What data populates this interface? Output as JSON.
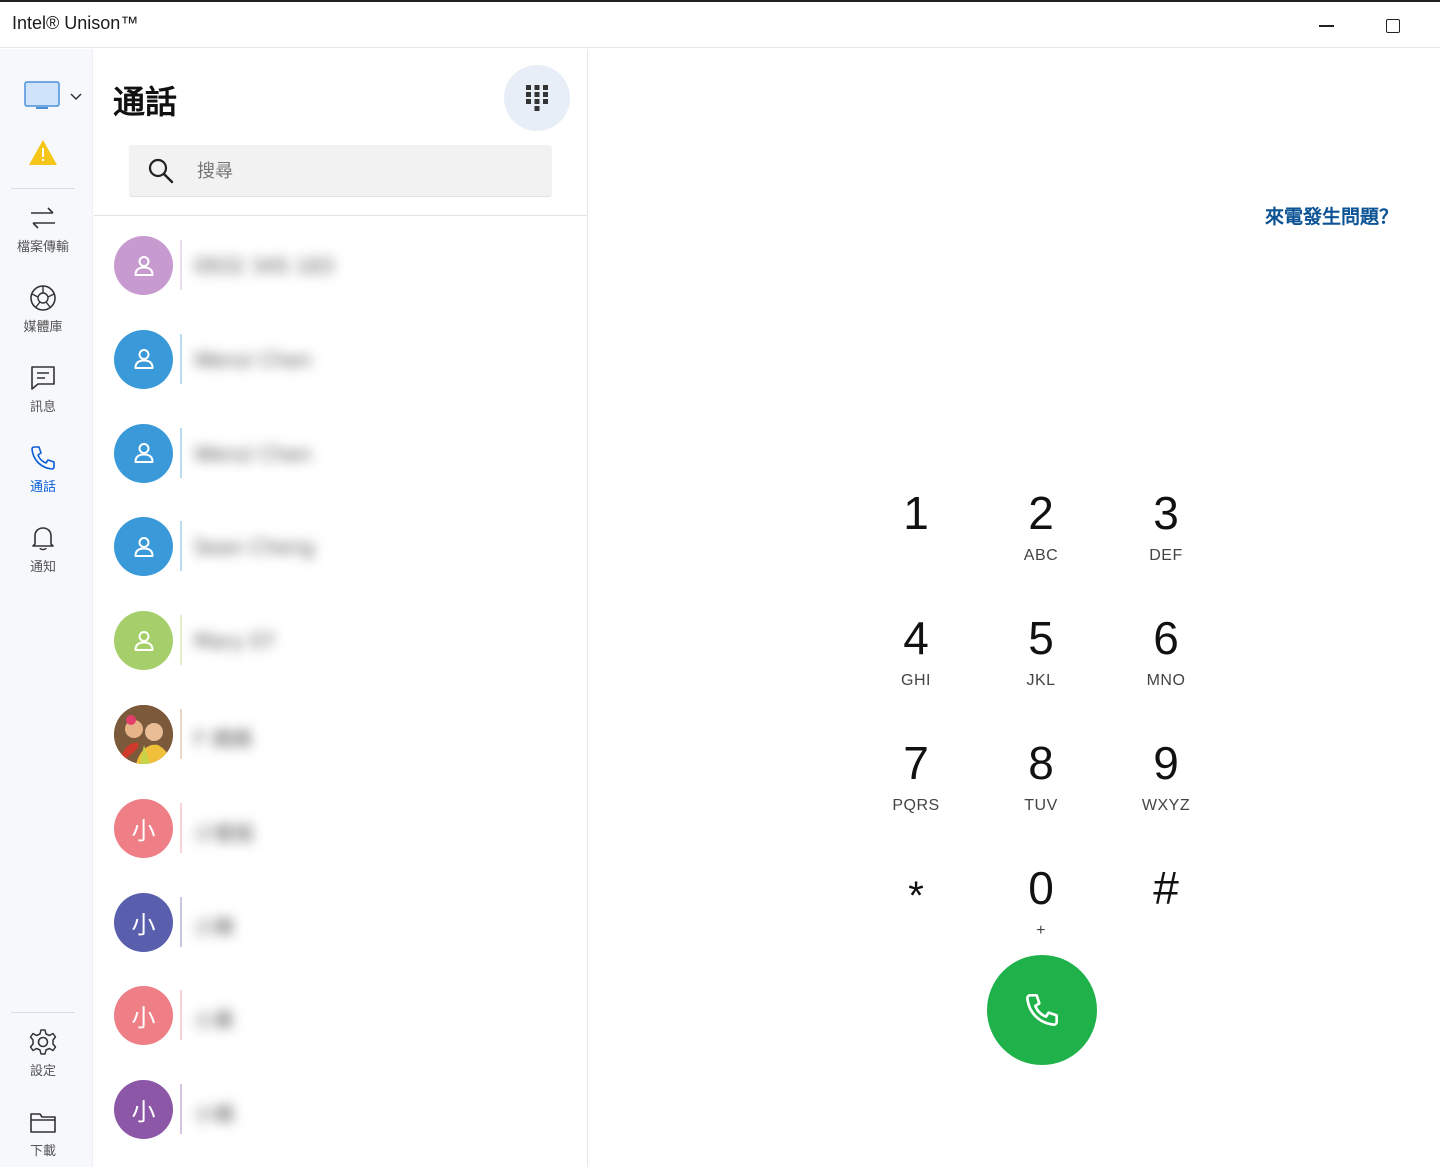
{
  "window": {
    "title": "Intel® Unison™"
  },
  "rail": {
    "device_icon": "monitor-icon",
    "warning_icon": "warning-icon",
    "items": [
      {
        "label": "檔案傳輸",
        "icon": "transfer-icon"
      },
      {
        "label": "媒體庫",
        "icon": "gallery-icon"
      },
      {
        "label": "訊息",
        "icon": "message-icon"
      },
      {
        "label": "通話",
        "icon": "phone-icon",
        "active": true
      },
      {
        "label": "通知",
        "icon": "bell-icon"
      }
    ],
    "bottom_items": [
      {
        "label": "設定",
        "icon": "gear-icon"
      },
      {
        "label": "下載",
        "icon": "folder-icon"
      }
    ],
    "active_color": "#0b5ed7"
  },
  "panel": {
    "title": "通話",
    "dialpad_icon": "dialpad-icon",
    "search": {
      "placeholder": "搜尋",
      "value": ""
    },
    "contacts": [
      {
        "initial": "",
        "color": "#c79bd0",
        "icon": "person-icon",
        "name": "0932 345 183"
      },
      {
        "initial": "",
        "color": "#3a9ad9",
        "icon": "person-icon",
        "name": "Wenzi Chen"
      },
      {
        "initial": "",
        "color": "#3a9ad9",
        "icon": "person-icon",
        "name": "Wenzi Chen"
      },
      {
        "initial": "",
        "color": "#3a9ad9",
        "icon": "person-icon",
        "name": "Sean Cheng"
      },
      {
        "initial": "",
        "color": "#a6cf6b",
        "icon": "person-icon",
        "name": "Mary 07"
      },
      {
        "initial": "",
        "color": "#c98a5c",
        "icon": "photo-avatar",
        "name": "F 媽媽"
      },
      {
        "initial": "小",
        "color": "#ee7f86",
        "icon": "",
        "name": "小瑩姐"
      },
      {
        "initial": "小",
        "color": "#5a5fad",
        "icon": "",
        "name": "小陳"
      },
      {
        "initial": "小",
        "color": "#ee7f86",
        "icon": "",
        "name": "小黃"
      },
      {
        "initial": "小",
        "color": "#8c57a6",
        "icon": "",
        "name": "小楊"
      }
    ]
  },
  "dialer": {
    "help_link": "來電發生問題？",
    "keys": [
      {
        "num": "1",
        "sub": ""
      },
      {
        "num": "2",
        "sub": "ABC"
      },
      {
        "num": "3",
        "sub": "DEF"
      },
      {
        "num": "4",
        "sub": "GHI"
      },
      {
        "num": "5",
        "sub": "JKL"
      },
      {
        "num": "6",
        "sub": "MNO"
      },
      {
        "num": "7",
        "sub": "PQRS"
      },
      {
        "num": "8",
        "sub": "TUV"
      },
      {
        "num": "9",
        "sub": "WXYZ"
      },
      {
        "num": "*",
        "sub": ""
      },
      {
        "num": "0",
        "sub": "+"
      },
      {
        "num": "#",
        "sub": ""
      }
    ],
    "call_icon": "phone-call-icon",
    "call_color": "#20b24a"
  }
}
